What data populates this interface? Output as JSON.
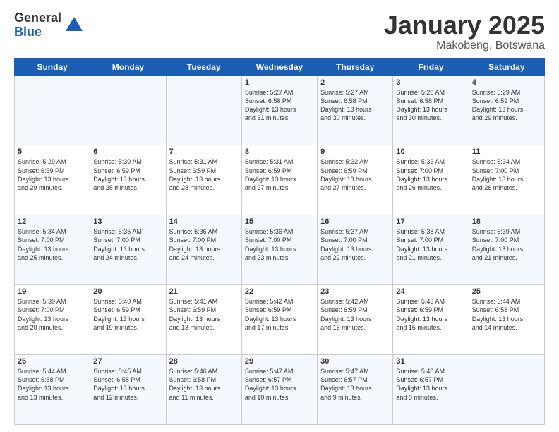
{
  "logo": {
    "general": "General",
    "blue": "Blue"
  },
  "header": {
    "month": "January 2025",
    "location": "Makobeng, Botswana"
  },
  "weekdays": [
    "Sunday",
    "Monday",
    "Tuesday",
    "Wednesday",
    "Thursday",
    "Friday",
    "Saturday"
  ],
  "weeks": [
    [
      {
        "day": "",
        "info": ""
      },
      {
        "day": "",
        "info": ""
      },
      {
        "day": "",
        "info": ""
      },
      {
        "day": "1",
        "info": "Sunrise: 5:27 AM\nSunset: 6:58 PM\nDaylight: 13 hours\nand 31 minutes."
      },
      {
        "day": "2",
        "info": "Sunrise: 5:27 AM\nSunset: 6:58 PM\nDaylight: 13 hours\nand 30 minutes."
      },
      {
        "day": "3",
        "info": "Sunrise: 5:28 AM\nSunset: 6:58 PM\nDaylight: 13 hours\nand 30 minutes."
      },
      {
        "day": "4",
        "info": "Sunrise: 5:29 AM\nSunset: 6:59 PM\nDaylight: 13 hours\nand 29 minutes."
      }
    ],
    [
      {
        "day": "5",
        "info": "Sunrise: 5:29 AM\nSunset: 6:59 PM\nDaylight: 13 hours\nand 29 minutes."
      },
      {
        "day": "6",
        "info": "Sunrise: 5:30 AM\nSunset: 6:59 PM\nDaylight: 13 hours\nand 28 minutes."
      },
      {
        "day": "7",
        "info": "Sunrise: 5:31 AM\nSunset: 6:59 PM\nDaylight: 13 hours\nand 28 minutes."
      },
      {
        "day": "8",
        "info": "Sunrise: 5:31 AM\nSunset: 6:59 PM\nDaylight: 13 hours\nand 27 minutes."
      },
      {
        "day": "9",
        "info": "Sunrise: 5:32 AM\nSunset: 6:59 PM\nDaylight: 13 hours\nand 27 minutes."
      },
      {
        "day": "10",
        "info": "Sunrise: 5:33 AM\nSunset: 7:00 PM\nDaylight: 13 hours\nand 26 minutes."
      },
      {
        "day": "11",
        "info": "Sunrise: 5:34 AM\nSunset: 7:00 PM\nDaylight: 13 hours\nand 26 minutes."
      }
    ],
    [
      {
        "day": "12",
        "info": "Sunrise: 5:34 AM\nSunset: 7:00 PM\nDaylight: 13 hours\nand 25 minutes."
      },
      {
        "day": "13",
        "info": "Sunrise: 5:35 AM\nSunset: 7:00 PM\nDaylight: 13 hours\nand 24 minutes."
      },
      {
        "day": "14",
        "info": "Sunrise: 5:36 AM\nSunset: 7:00 PM\nDaylight: 13 hours\nand 24 minutes."
      },
      {
        "day": "15",
        "info": "Sunrise: 5:36 AM\nSunset: 7:00 PM\nDaylight: 13 hours\nand 23 minutes."
      },
      {
        "day": "16",
        "info": "Sunrise: 5:37 AM\nSunset: 7:00 PM\nDaylight: 13 hours\nand 22 minutes."
      },
      {
        "day": "17",
        "info": "Sunrise: 5:38 AM\nSunset: 7:00 PM\nDaylight: 13 hours\nand 21 minutes."
      },
      {
        "day": "18",
        "info": "Sunrise: 5:39 AM\nSunset: 7:00 PM\nDaylight: 13 hours\nand 21 minutes."
      }
    ],
    [
      {
        "day": "19",
        "info": "Sunrise: 5:39 AM\nSunset: 7:00 PM\nDaylight: 13 hours\nand 20 minutes."
      },
      {
        "day": "20",
        "info": "Sunrise: 5:40 AM\nSunset: 6:59 PM\nDaylight: 13 hours\nand 19 minutes."
      },
      {
        "day": "21",
        "info": "Sunrise: 5:41 AM\nSunset: 6:59 PM\nDaylight: 13 hours\nand 18 minutes."
      },
      {
        "day": "22",
        "info": "Sunrise: 5:42 AM\nSunset: 6:59 PM\nDaylight: 13 hours\nand 17 minutes."
      },
      {
        "day": "23",
        "info": "Sunrise: 5:42 AM\nSunset: 6:59 PM\nDaylight: 13 hours\nand 16 minutes."
      },
      {
        "day": "24",
        "info": "Sunrise: 5:43 AM\nSunset: 6:59 PM\nDaylight: 13 hours\nand 15 minutes."
      },
      {
        "day": "25",
        "info": "Sunrise: 5:44 AM\nSunset: 6:58 PM\nDaylight: 13 hours\nand 14 minutes."
      }
    ],
    [
      {
        "day": "26",
        "info": "Sunrise: 5:44 AM\nSunset: 6:58 PM\nDaylight: 13 hours\nand 13 minutes."
      },
      {
        "day": "27",
        "info": "Sunrise: 5:45 AM\nSunset: 6:58 PM\nDaylight: 13 hours\nand 12 minutes."
      },
      {
        "day": "28",
        "info": "Sunrise: 5:46 AM\nSunset: 6:58 PM\nDaylight: 13 hours\nand 11 minutes."
      },
      {
        "day": "29",
        "info": "Sunrise: 5:47 AM\nSunset: 6:57 PM\nDaylight: 13 hours\nand 10 minutes."
      },
      {
        "day": "30",
        "info": "Sunrise: 5:47 AM\nSunset: 6:57 PM\nDaylight: 13 hours\nand 9 minutes."
      },
      {
        "day": "31",
        "info": "Sunrise: 5:48 AM\nSunset: 6:57 PM\nDaylight: 13 hours\nand 8 minutes."
      },
      {
        "day": "",
        "info": ""
      }
    ]
  ]
}
